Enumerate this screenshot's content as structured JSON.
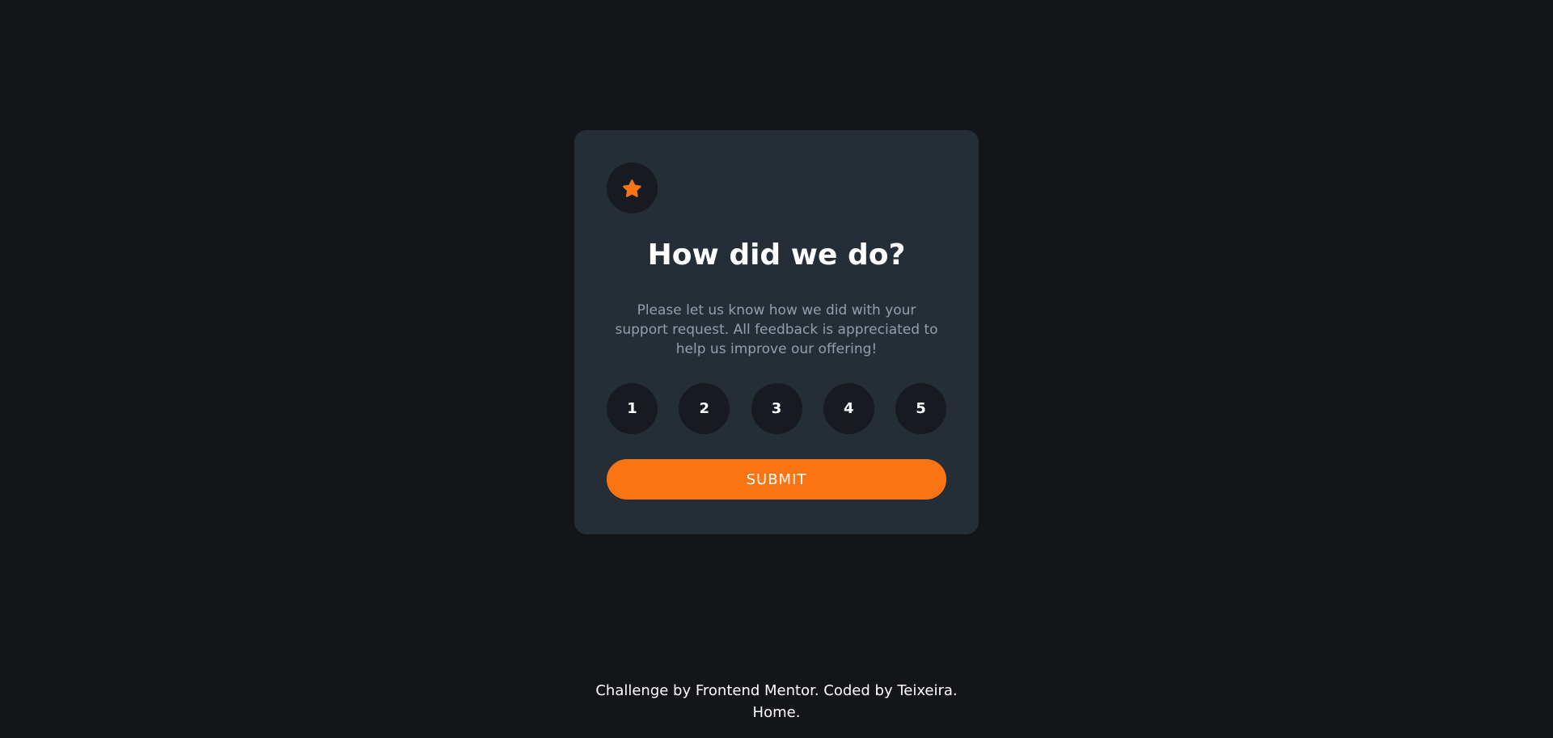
{
  "card": {
    "icon": "star-icon",
    "title": "How did we do?",
    "description": "Please let us know how we did with your support request. All feedback is appreciated to help us improve our offering!",
    "ratings": [
      "1",
      "2",
      "3",
      "4",
      "5"
    ],
    "submit_label": "SUBMIT"
  },
  "footer": {
    "line1": "Challenge by Frontend Mentor. Coded by Teixeira.",
    "line2": "Home."
  },
  "colors": {
    "background": "#131518",
    "card": "#252d37",
    "circle": "#171b21",
    "accent": "#fb7413",
    "muted_text": "#959eac"
  }
}
